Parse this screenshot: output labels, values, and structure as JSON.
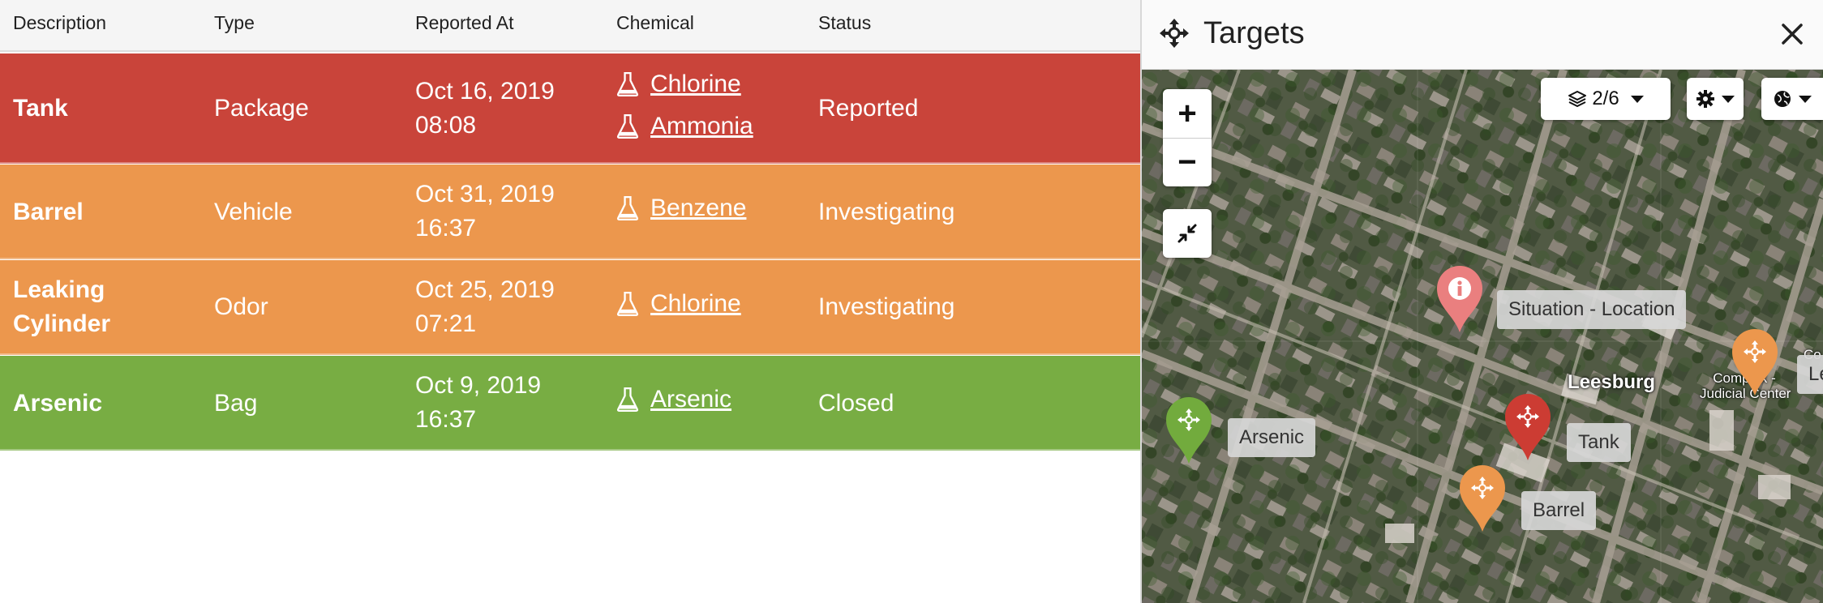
{
  "table": {
    "headers": {
      "description": "Description",
      "type": "Type",
      "reported_at": "Reported At",
      "chemical": "Chemical",
      "status": "Status"
    },
    "rows": [
      {
        "description": "Tank",
        "type": "Package",
        "date_line1": "Oct 16, 2019",
        "date_line2": "08:08",
        "chemicals": [
          "Chlorine",
          "Ammonia"
        ],
        "status": "Reported",
        "color": "#c9443a"
      },
      {
        "description": "Barrel",
        "type": "Vehicle",
        "date_line1": "Oct 31, 2019",
        "date_line2": "16:37",
        "chemicals": [
          "Benzene"
        ],
        "status": "Investigating",
        "color": "#ec974d"
      },
      {
        "description_line1": "Leaking",
        "description_line2": "Cylinder",
        "type": "Odor",
        "date_line1": "Oct 25, 2019",
        "date_line2": "07:21",
        "chemicals": [
          "Chlorine"
        ],
        "status": "Investigating",
        "color": "#ec974d"
      },
      {
        "description": "Arsenic",
        "type": "Bag",
        "date_line1": "Oct 9, 2019",
        "date_line2": "16:37",
        "chemicals": [
          "Arsenic"
        ],
        "status": "Closed",
        "color": "#78ad43"
      }
    ],
    "chemical_icon": "flask-icon"
  },
  "panel": {
    "title": "Targets",
    "title_icon": "crosshair-move-icon",
    "close_icon": "close-icon"
  },
  "map": {
    "zoom_in": "+",
    "zoom_out": "−",
    "collapse_icon": "compress-icon",
    "layers_label": "2/6",
    "layers_icon": "layers-icon",
    "settings_icon": "gear-icon",
    "basemap_icon": "globe-icon",
    "place_label": "Leesburg",
    "markers": [
      {
        "label": "Situation - Location",
        "icon": "info-icon",
        "color": "#ea7f7f"
      },
      {
        "label": "Tank",
        "icon": "crosshair-move-icon",
        "color": "#cc3c33"
      },
      {
        "label": "Barrel",
        "icon": "crosshair-move-icon",
        "color": "#ec974d"
      },
      {
        "label": "Arsenic",
        "icon": "crosshair-move-icon",
        "color": "#72ab3d"
      },
      {
        "label": "Le",
        "icon": "crosshair-move-icon",
        "color": "#ec974d"
      }
    ],
    "poi_lines": [
      "Co",
      "Complex -",
      "Judicial Center"
    ],
    "poi_edge": "Co"
  }
}
